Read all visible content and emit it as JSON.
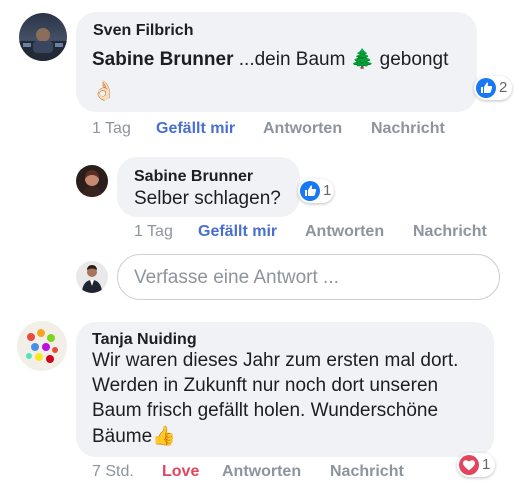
{
  "comments": [
    {
      "author": "Sven Filbrich",
      "mention": "Sabine Brunner",
      "text_before_emoji": " ...dein Baum ",
      "emoji_tree": "🌲",
      "text_after_emoji": " gebongt",
      "emoji_ok": "👌🏻",
      "time": "1 Tag",
      "like_label": "Gefällt mir",
      "reply_label": "Antworten",
      "message_label": "Nachricht",
      "reaction_icon": "thumbs-up-icon",
      "reaction_count": "2"
    },
    {
      "author": "Sabine Brunner",
      "text": "Selber schlagen?",
      "time": "1 Tag",
      "like_label": "Gefällt mir",
      "reply_label": "Antworten",
      "message_label": "Nachricht",
      "reaction_icon": "thumbs-up-icon",
      "reaction_count": "1"
    },
    {
      "author": "Tanja Nuiding",
      "text_lines": [
        "Wir waren dieses Jahr zum ersten mal dort.",
        "Werden in Zukunft nur noch dort unseren",
        "Baum frisch gefällt holen. Wunderschöne"
      ],
      "last_line": "Bäume",
      "emoji_thumb": "👍",
      "time": "7 Std.",
      "like_label": "Love",
      "reply_label": "Antworten",
      "message_label": "Nachricht",
      "reaction_icon": "heart-icon",
      "reaction_count": "1"
    }
  ],
  "reply_box": {
    "placeholder": "Verfasse eine Antwort ..."
  },
  "colors": {
    "bubble": "#f0f2f5",
    "like_blue": "#4a6fd1",
    "love_red": "#e0465e",
    "meta_grey": "#8d949e",
    "reaction_blue": "#1877f2"
  }
}
